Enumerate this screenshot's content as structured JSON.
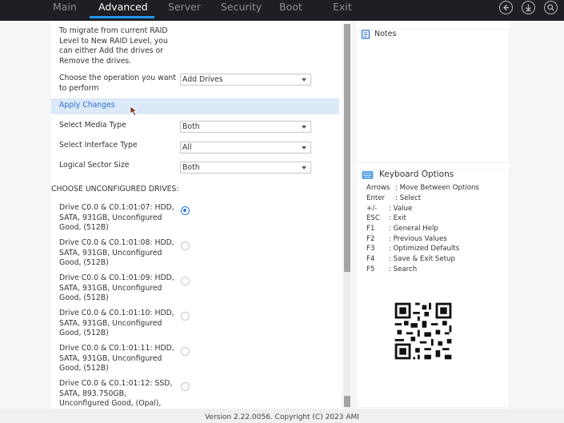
{
  "tabs": [
    {
      "label": "Main"
    },
    {
      "label": "Advanced"
    },
    {
      "label": "Server"
    },
    {
      "label": "Security"
    },
    {
      "label": "Boot"
    },
    {
      "label": "Exit"
    }
  ],
  "active_tab": "Advanced",
  "main": {
    "intro": [
      "To migrate from current RAID",
      "Level to New RAID Level, you",
      "can either Add the drives or",
      "Remove the drives."
    ],
    "operation_label": [
      "Choose the operation you want",
      "to perform"
    ],
    "operation_value": "Add Drives",
    "apply_changes": "Apply Changes",
    "media_type_label": "Select Media Type",
    "media_type_value": "Both",
    "interface_type_label": "Select Interface Type",
    "interface_type_value": "All",
    "sector_size_label": "Logical Sector Size",
    "sector_size_value": "Both",
    "drives_heading": "CHOOSE UNCONFIGURED DRIVES:",
    "drives": [
      {
        "lines": [
          "Drive C0.0 & C0.1:01:07: HDD,",
          "SATA, 931GB, Unconfigured",
          "Good, (512B)"
        ],
        "selected": true
      },
      {
        "lines": [
          "Drive C0.0 & C0.1:01:08: HDD,",
          "SATA, 931GB, Unconfigured",
          "Good, (512B)"
        ],
        "selected": false
      },
      {
        "lines": [
          "Drive C0.0 & C0.1:01:09: HDD,",
          "SATA, 931GB, Unconfigured",
          "Good, (512B)"
        ],
        "selected": false
      },
      {
        "lines": [
          "Drive C0.0 & C0.1:01:10: HDD,",
          "SATA, 931GB, Unconfigured",
          "Good, (512B)"
        ],
        "selected": false
      },
      {
        "lines": [
          "Drive C0.0 & C0.1:01:11: HDD,",
          "SATA, 931GB, Unconfigured",
          "Good, (512B)"
        ],
        "selected": false
      },
      {
        "lines": [
          "Drive C0.0 & C0.1:01:12: SSD,",
          "SATA, 893.750GB,",
          "Unconfigured Good, (Opal),"
        ],
        "selected": false
      }
    ]
  },
  "notes": {
    "title": "Notes"
  },
  "keyboard": {
    "title": "Keyboard Options",
    "items": [
      {
        "key": "Arrows",
        "desc": ": Move Between Options"
      },
      {
        "key": "Enter",
        "desc": ": Select"
      },
      {
        "key": "+/-",
        "desc": ": Value"
      },
      {
        "key": "ESC",
        "desc": ": Exit"
      },
      {
        "key": "F1",
        "desc": ": General Help"
      },
      {
        "key": "F2",
        "desc": ": Previous Values"
      },
      {
        "key": "F3",
        "desc": ": Optimized Defaults"
      },
      {
        "key": "F4",
        "desc": ": Save & Exit Setup"
      },
      {
        "key": "F5",
        "desc": ": Search"
      }
    ]
  },
  "footer": "Version 2.22.0056. Copyright (C) 2023 AMI",
  "icons": {
    "back": "back-arrow-icon",
    "save": "download-icon",
    "search": "search-icon",
    "notes": "notes-icon",
    "keyboard": "keyboard-icon",
    "qr": "qr-code-icon"
  },
  "colors": {
    "topbar": "#1d1f24",
    "accent": "#2196f3",
    "highlight": "#dbe9f8",
    "link": "#2f6fd1"
  }
}
